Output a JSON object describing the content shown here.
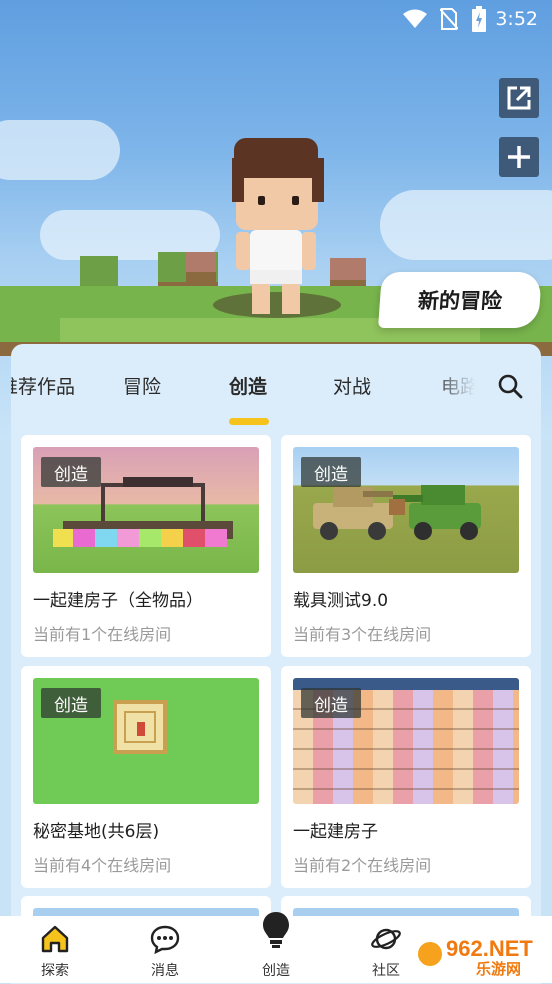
{
  "status_bar": {
    "time": "3:52"
  },
  "hero": {
    "new_adventure_label": "新的冒险"
  },
  "tabs": [
    {
      "label": "推荐作品",
      "active": false
    },
    {
      "label": "冒险",
      "active": false
    },
    {
      "label": "创造",
      "active": true
    },
    {
      "label": "对战",
      "active": false
    },
    {
      "label": "电路",
      "active": false
    }
  ],
  "cards": [
    {
      "badge": "创造",
      "title": "一起建房子（全物品）",
      "subtitle": "当前有1个在线房间"
    },
    {
      "badge": "创造",
      "title": "载具测试9.0",
      "subtitle": "当前有3个在线房间"
    },
    {
      "badge": "创造",
      "title": "秘密基地(共6层)",
      "subtitle": "当前有4个在线房间"
    },
    {
      "badge": "创造",
      "title": "一起建房子",
      "subtitle": "当前有2个在线房间"
    }
  ],
  "bottom_nav": [
    {
      "label": "探索",
      "icon": "home-icon",
      "active": true
    },
    {
      "label": "消息",
      "icon": "chat-icon",
      "active": false
    },
    {
      "label": "创造",
      "icon": "bulb-icon",
      "active": false
    },
    {
      "label": "社区",
      "icon": "planet-icon",
      "active": false
    }
  ],
  "watermark": {
    "text_top": "962.NET",
    "text_bottom": "乐游网"
  },
  "colors": {
    "accent_yellow": "#f6c21c",
    "panel_bg": "#dbedfb",
    "badge_bg": "#2d3430"
  }
}
